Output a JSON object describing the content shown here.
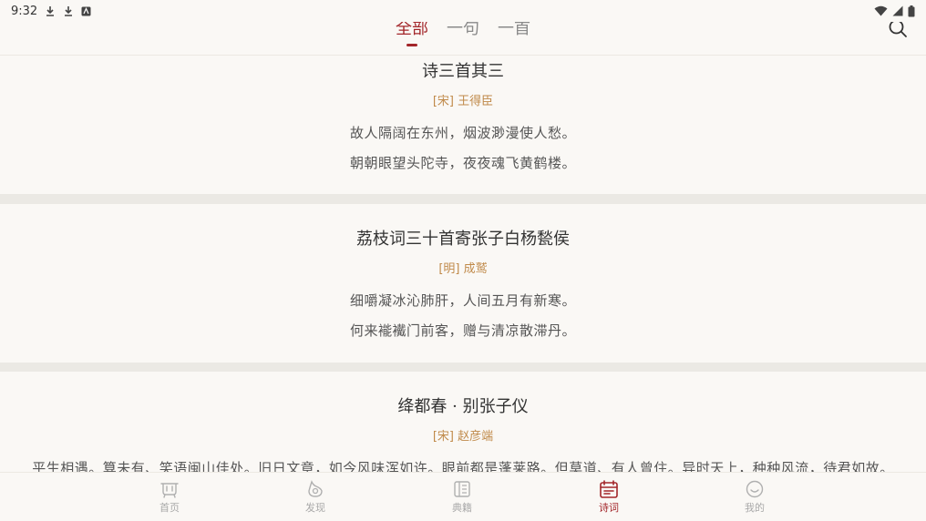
{
  "status": {
    "time": "9:32"
  },
  "tabs": [
    {
      "label": "全部",
      "active": true
    },
    {
      "label": "一句",
      "active": false
    },
    {
      "label": "一首",
      "active": false
    }
  ],
  "poems": [
    {
      "title": "诗三首其三",
      "author": "[宋] 王得臣",
      "lines": [
        "故人隔阔在东州，烟波渺漫使人愁。",
        "朝朝眼望头陀寺，夜夜魂飞黄鹤楼。"
      ]
    },
    {
      "title": "荔枝词三十首寄张子白杨甃侯",
      "author": "[明] 成鹫",
      "lines": [
        "细嚼凝冰沁肺肝，人间五月有新寒。",
        "何来褦襶门前客，赠与清凉散滞丹。"
      ]
    },
    {
      "title": "绛都春 · 别张子仪",
      "author": "[宋] 赵彦端",
      "lines": [
        "平生相遇。算未有、笑语闽山佳处。旧日文章，如今风味浑如许。眼前都是蓬莱路。但莫道、有人曾住。异时天上，种种风流，待君如故。"
      ]
    }
  ],
  "nav": [
    {
      "label": "首页",
      "icon": "home-icon",
      "active": false
    },
    {
      "label": "发现",
      "icon": "discover-icon",
      "active": false
    },
    {
      "label": "典籍",
      "icon": "books-icon",
      "active": false
    },
    {
      "label": "诗词",
      "icon": "poetry-icon",
      "active": true
    },
    {
      "label": "我的",
      "icon": "profile-icon",
      "active": false
    }
  ],
  "colors": {
    "accent": "#a3262a",
    "author": "#c08a4a",
    "background": "#faf8f5",
    "separator": "#ebe9e4"
  }
}
